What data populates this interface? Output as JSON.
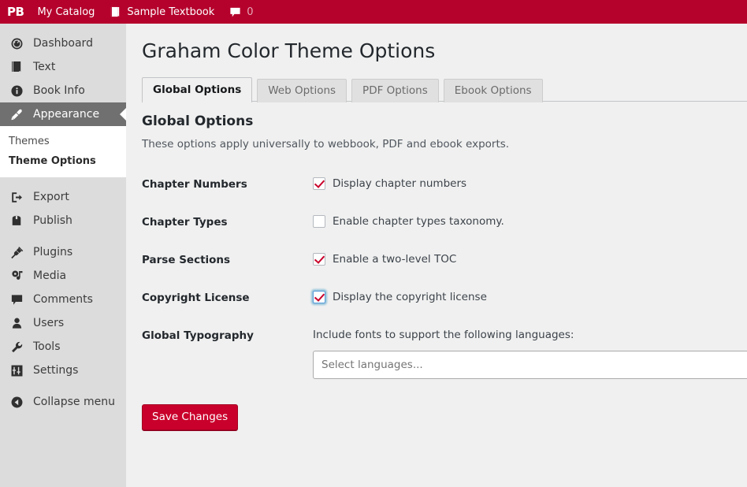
{
  "adminbar": {
    "logo": "PB",
    "items": [
      {
        "label": "My Catalog",
        "icon": ""
      },
      {
        "label": "Sample Textbook",
        "icon": "book-icon"
      },
      {
        "label": "0",
        "icon": "comment-icon"
      }
    ],
    "bg_color": "#b5022c"
  },
  "sidebar": {
    "bg_color": "#dcdcdc",
    "active_bg_color": "#707070",
    "groups": [
      {
        "items": [
          {
            "label": "Dashboard",
            "icon": "dashboard-icon",
            "active": false
          },
          {
            "label": "Text",
            "icon": "book-icon",
            "active": false
          },
          {
            "label": "Book Info",
            "icon": "info-icon",
            "active": false
          },
          {
            "label": "Appearance",
            "icon": "brush-icon",
            "active": true
          }
        ]
      },
      {
        "items": [
          {
            "label": "Export",
            "icon": "export-icon",
            "active": false
          },
          {
            "label": "Publish",
            "icon": "publish-icon",
            "active": false
          }
        ]
      },
      {
        "items": [
          {
            "label": "Plugins",
            "icon": "plug-icon",
            "active": false
          },
          {
            "label": "Media",
            "icon": "media-icon",
            "active": false
          },
          {
            "label": "Comments",
            "icon": "comment-icon",
            "active": false
          },
          {
            "label": "Users",
            "icon": "user-icon",
            "active": false
          },
          {
            "label": "Tools",
            "icon": "wrench-icon",
            "active": false
          },
          {
            "label": "Settings",
            "icon": "sliders-icon",
            "active": false
          }
        ]
      },
      {
        "items": [
          {
            "label": "Collapse menu",
            "icon": "collapse-arrow-icon",
            "active": false
          }
        ]
      }
    ],
    "submenu": [
      {
        "label": "Themes",
        "current": false
      },
      {
        "label": "Theme Options",
        "current": true
      }
    ]
  },
  "main": {
    "page_title": "Graham Color Theme Options",
    "tabs": [
      {
        "label": "Global Options",
        "active": true
      },
      {
        "label": "Web Options",
        "active": false
      },
      {
        "label": "PDF Options",
        "active": false
      },
      {
        "label": "Ebook Options",
        "active": false
      }
    ],
    "section": {
      "title": "Global Options",
      "description": "These options apply universally to webbook, PDF and ebook exports."
    },
    "fields": [
      {
        "label": "Chapter Numbers",
        "checkbox_label": "Display chapter numbers",
        "checked": true,
        "focused": false
      },
      {
        "label": "Chapter Types",
        "checkbox_label": "Enable chapter types taxonomy.",
        "checked": false,
        "focused": false
      },
      {
        "label": "Parse Sections",
        "checkbox_label": "Enable a two-level TOC",
        "checked": true,
        "focused": false
      },
      {
        "label": "Copyright License",
        "checkbox_label": "Display the copyright license",
        "checked": true,
        "focused": true
      }
    ],
    "typography": {
      "label": "Global Typography",
      "description": "Include fonts to support the following languages:",
      "select_value": "",
      "select_placeholder": "Select languages..."
    },
    "submit_label": "Save Changes",
    "accent_color": "#c9002b",
    "check_color": "#c9002b",
    "focus_color": "#5b9dd9"
  }
}
